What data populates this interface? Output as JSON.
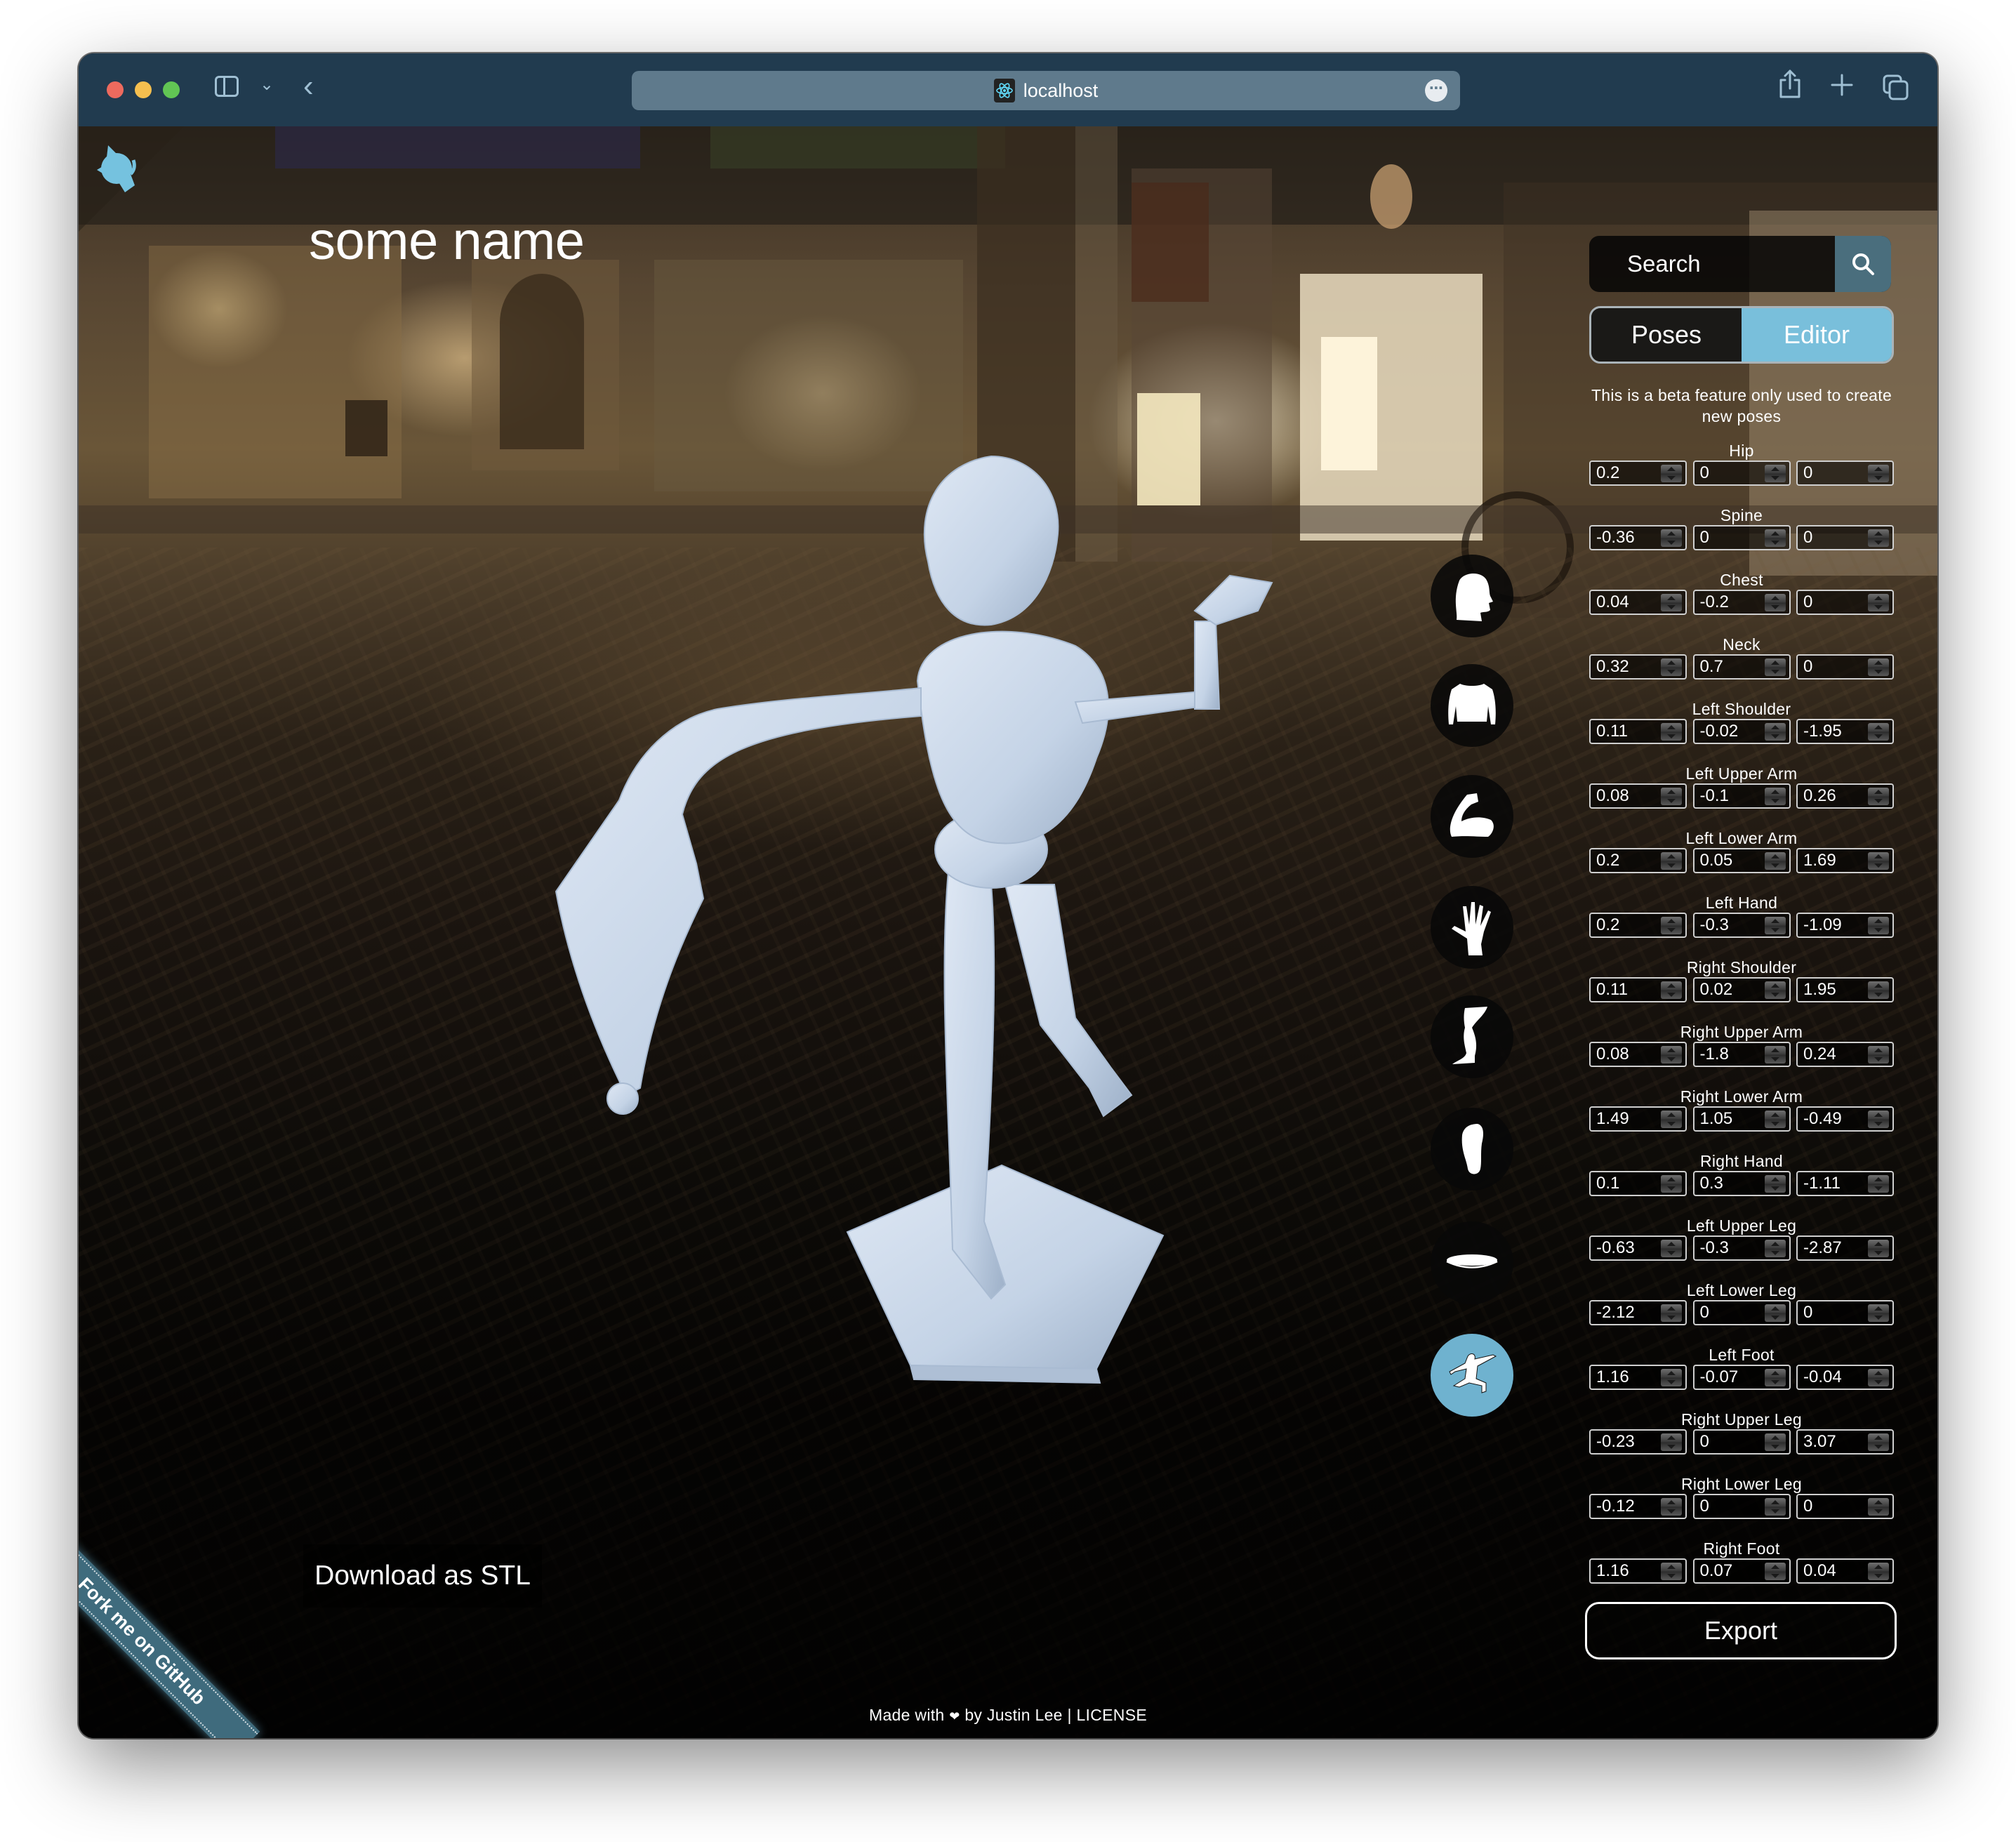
{
  "browser": {
    "url": "localhost",
    "favicon": "react-atom-icon",
    "toolbar_icons": [
      "sidebar-icon",
      "chevron-down-icon",
      "back-icon",
      "share-icon",
      "plus-icon",
      "tabs-icon"
    ],
    "more_icon": "ellipsis-icon"
  },
  "page": {
    "title": "some name",
    "github_corner_icon": "octocat-icon",
    "download_label": "Download as STL",
    "fork_ribbon": "Fork me on GitHub",
    "footer": {
      "made_with": "Made with",
      "heart": "❤",
      "by": "by Justin Lee",
      "separator": "|",
      "license": "LICENSE"
    }
  },
  "categories": [
    {
      "name": "head",
      "icon": "head-icon",
      "active": false
    },
    {
      "name": "torso",
      "icon": "torso-icon",
      "active": false
    },
    {
      "name": "arm",
      "icon": "arm-icon",
      "active": false
    },
    {
      "name": "hand",
      "icon": "hand-icon",
      "active": false
    },
    {
      "name": "leg",
      "icon": "leg-icon",
      "active": false
    },
    {
      "name": "foot",
      "icon": "foot-icon",
      "active": false
    },
    {
      "name": "stand",
      "icon": "stand-icon",
      "active": false
    },
    {
      "name": "pose",
      "icon": "pose-icon",
      "active": true
    }
  ],
  "panel": {
    "search_placeholder": "Search",
    "search_icon": "search-icon",
    "tabs": [
      {
        "label": "Poses",
        "active": false
      },
      {
        "label": "Editor",
        "active": true
      }
    ],
    "beta_note": "This is a beta feature only used to create new poses",
    "bones": [
      {
        "label": "Hip",
        "values": [
          "0.2",
          "0",
          "0"
        ]
      },
      {
        "label": "Spine",
        "values": [
          "-0.36",
          "0",
          "0"
        ]
      },
      {
        "label": "Chest",
        "values": [
          "0.04",
          "-0.2",
          "0"
        ]
      },
      {
        "label": "Neck",
        "values": [
          "0.32",
          "0.7",
          "0"
        ]
      },
      {
        "label": "Left Shoulder",
        "values": [
          "0.11",
          "-0.02",
          "-1.95"
        ]
      },
      {
        "label": "Left Upper Arm",
        "values": [
          "0.08",
          "-0.1",
          "0.26"
        ]
      },
      {
        "label": "Left Lower Arm",
        "values": [
          "0.2",
          "0.05",
          "1.69"
        ]
      },
      {
        "label": "Left Hand",
        "values": [
          "0.2",
          "-0.3",
          "-1.09"
        ]
      },
      {
        "label": "Right Shoulder",
        "values": [
          "0.11",
          "0.02",
          "1.95"
        ]
      },
      {
        "label": "Right Upper Arm",
        "values": [
          "0.08",
          "-1.8",
          "0.24"
        ]
      },
      {
        "label": "Right Lower Arm",
        "values": [
          "1.49",
          "1.05",
          "-0.49"
        ]
      },
      {
        "label": "Right Hand",
        "values": [
          "0.1",
          "0.3",
          "-1.11"
        ]
      },
      {
        "label": "Left Upper Leg",
        "values": [
          "-0.63",
          "-0.3",
          "-2.87"
        ]
      },
      {
        "label": "Left Lower Leg",
        "values": [
          "-2.12",
          "0",
          "0"
        ]
      },
      {
        "label": "Left Foot",
        "values": [
          "1.16",
          "-0.07",
          "-0.04"
        ]
      },
      {
        "label": "Right Upper Leg",
        "values": [
          "-0.23",
          "0",
          "3.07"
        ]
      },
      {
        "label": "Right Lower Leg",
        "values": [
          "-0.12",
          "0",
          "0"
        ]
      },
      {
        "label": "Right Foot",
        "values": [
          "1.16",
          "0.07",
          "0.04"
        ]
      }
    ],
    "export_label": "Export"
  },
  "colors": {
    "titlebar": "#213b4f",
    "urlbar": "#5f7a8c",
    "accent": "#79bfdb",
    "active_category": "#6fb2cf",
    "search_button": "#4a6e7d",
    "model": "#c9d6e8"
  }
}
